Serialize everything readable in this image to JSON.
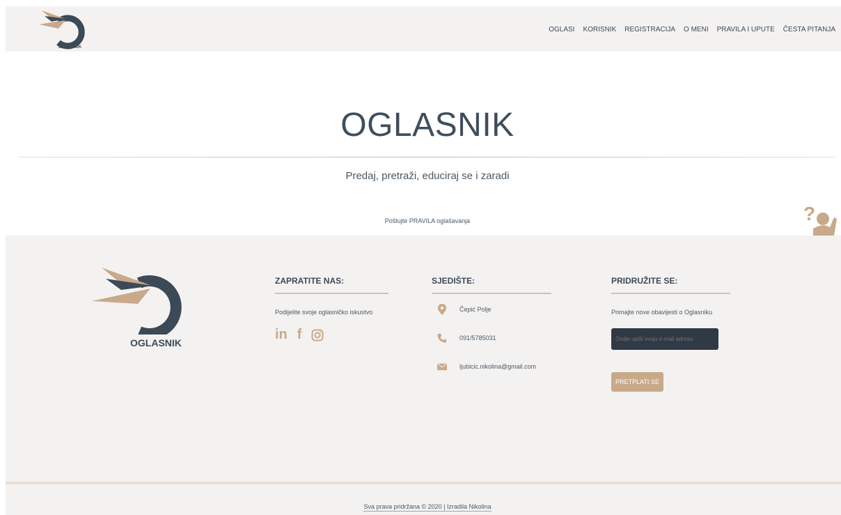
{
  "nav": {
    "logo_text": "OGLASNIK",
    "links": [
      "OGLASI",
      "KORISNIK",
      "REGISTRACIJA",
      "O MENI",
      "PRAVILA I UPUTE",
      "ČESTA PITANJA"
    ]
  },
  "hero": {
    "title": "OGLASNIK",
    "subtitle": "Predaj, pretraži, educiraj se i zaradi"
  },
  "footer": {
    "logo_text": "OGLASNIK",
    "follow": {
      "title": "ZAPRATITE NAS:",
      "text": "Podijelite svoje oglasničko iskustvo",
      "icons": [
        "linkedin-icon",
        "facebook-icon",
        "instagram-icon"
      ]
    },
    "hq": {
      "title": "SJEDIŠTE:",
      "address": "Čepić Polje",
      "phone": "091/5785031",
      "email": "ljubicic.nikolina@gmail.com"
    },
    "join": {
      "title": "PRIDRUŽITE SE:",
      "text": "Primajte nove obavijesti o Oglasniku",
      "placeholder": "Ovdje upiši svoju e-mail adresu",
      "button": "PRETPLATI SE"
    },
    "rules_text": "Poštujte PRAVILA oglašavanja",
    "copyright": "Sva prava pridržana © 2020 | Izradila Nikolina"
  },
  "colors": {
    "dark": "#3c4a57",
    "accent": "#c8a989",
    "bg": "#f4f2f1"
  }
}
